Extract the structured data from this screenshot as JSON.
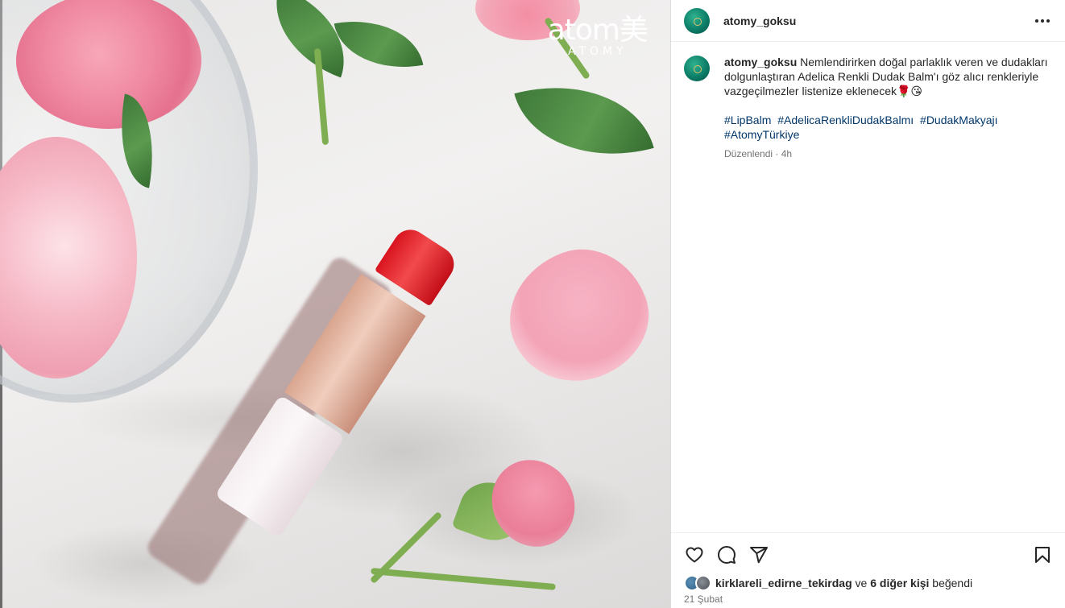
{
  "post_image": {
    "brand_logo_mark": "atom美",
    "brand_logo_sub": "ATOMY"
  },
  "header": {
    "username": "atomy_goksu"
  },
  "caption": {
    "username": "atomy_goksu",
    "text": "Nemlendirirken doğal parlaklık veren ve dudakları dolgunlaştıran Adelica Renkli Dudak Balm'ı göz alıcı renkleriyle vazgeçilmezler listenize eklenecek🌹😘",
    "hashtags": [
      "#LipBalm",
      "#AdelicaRenkliDudakBalmı",
      "#DudakMakyajı",
      "#AtomyTürkiye"
    ],
    "meta": "Düzenlendi · 4h"
  },
  "actions": {
    "icons": [
      "heart-icon",
      "comment-icon",
      "share-icon",
      "bookmark-icon"
    ]
  },
  "likes": {
    "first_user": "kirklareli_edirne_tekirdag",
    "connector": " ve ",
    "others": "6 diğer kişi",
    "suffix": " beğendi"
  },
  "date": "21 Şubat"
}
